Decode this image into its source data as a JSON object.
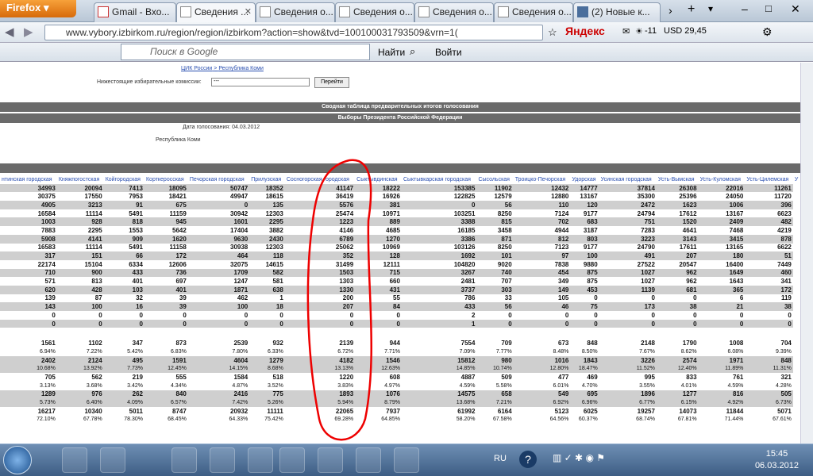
{
  "browser": {
    "menu_label": "Firefox",
    "tabs": [
      "Gmail - Вхо...",
      "Сведения ...",
      "Сведения о...",
      "Сведения о...",
      "Сведения о...",
      "Сведения о...",
      "(2) Новые к..."
    ],
    "url": "www.vybory.izbirkom.ru/region/region/izbirkom?action=show&tvd=100100031793509&vrn=1(",
    "yandex": "Яндекс",
    "temp": "-11",
    "usd": "USD 29,45",
    "search_placeholder": "Поиск в Google",
    "find_label": "Найти",
    "login_label": "Войти"
  },
  "page": {
    "breadcrumb": [
      "ЦИК России",
      ">",
      "Республика Коми"
    ],
    "commission_label": "Нижестоящие избирательные комиссии:",
    "commission_value": "---",
    "go_label": "Перейти",
    "title1": "Сводная таблица предварительных итогов голосования",
    "title2": "Выборы Президента Российской Федерации",
    "date_label": "Дата голосования:",
    "date_value": "04.03.2012",
    "region": "Республика Коми"
  },
  "table": {
    "headers": [
      "нтинская городская",
      "Княжпогостская",
      "Койгородская",
      "Корткеросская",
      "Печорская городская",
      "Прилузская",
      "Сосногорская городская",
      "Сыктывдинская",
      "Сыктывкарская городская",
      "Сысольская",
      "Троицко-Печорская",
      "Удорская",
      "Усинская городская",
      "Усть-Вымская",
      "Усть-Куломская",
      "Усть-Цилемская",
      "У"
    ],
    "rows": [
      [
        "34993",
        "20094",
        "7413",
        "18095",
        "50747",
        "18352",
        "41147",
        "18222",
        "153385",
        "11902",
        "12432",
        "14777",
        "37814",
        "26308",
        "22016",
        "11261"
      ],
      [
        "30375",
        "17550",
        "7953",
        "18421",
        "49947",
        "18615",
        "36419",
        "16926",
        "122825",
        "12579",
        "12880",
        "13167",
        "35300",
        "25396",
        "24050",
        "11720"
      ],
      [
        "4905",
        "3213",
        "91",
        "675",
        "0",
        "135",
        "5576",
        "381",
        "0",
        "56",
        "110",
        "120",
        "2472",
        "1623",
        "1006",
        "396"
      ],
      [
        "16584",
        "11114",
        "5491",
        "11159",
        "30942",
        "12303",
        "25474",
        "10971",
        "103251",
        "8250",
        "7124",
        "9177",
        "24794",
        "17612",
        "13167",
        "6623"
      ],
      [
        "1003",
        "928",
        "818",
        "945",
        "1601",
        "2295",
        "1223",
        "889",
        "3388",
        "815",
        "702",
        "683",
        "751",
        "1520",
        "2409",
        "482"
      ],
      [
        "7883",
        "2295",
        "1553",
        "5642",
        "17404",
        "3882",
        "4146",
        "4685",
        "16185",
        "3458",
        "4944",
        "3187",
        "7283",
        "4641",
        "7468",
        "4219"
      ],
      [
        "5908",
        "4141",
        "909",
        "1620",
        "9630",
        "2430",
        "6789",
        "1270",
        "3386",
        "871",
        "812",
        "803",
        "3223",
        "3143",
        "3415",
        "878"
      ],
      [
        "16583",
        "11114",
        "5491",
        "11158",
        "30938",
        "12303",
        "25062",
        "10969",
        "103126",
        "8250",
        "7123",
        "9177",
        "24790",
        "17611",
        "13165",
        "6622"
      ],
      [
        "317",
        "151",
        "66",
        "172",
        "464",
        "118",
        "352",
        "128",
        "1692",
        "101",
        "97",
        "100",
        "491",
        "207",
        "180",
        "51"
      ],
      [
        "22174",
        "15104",
        "6334",
        "12606",
        "32075",
        "14615",
        "31499",
        "12111",
        "104820",
        "9020",
        "7838",
        "9880",
        "27522",
        "20547",
        "16400",
        "7449"
      ],
      [
        "710",
        "900",
        "433",
        "736",
        "1709",
        "582",
        "1503",
        "715",
        "3267",
        "740",
        "454",
        "875",
        "1027",
        "962",
        "1649",
        "460"
      ],
      [
        "571",
        "813",
        "401",
        "697",
        "1247",
        "581",
        "1303",
        "660",
        "2481",
        "707",
        "349",
        "875",
        "1027",
        "962",
        "1643",
        "341"
      ],
      [
        "620",
        "428",
        "103",
        "401",
        "1871",
        "638",
        "1330",
        "431",
        "3737",
        "303",
        "149",
        "453",
        "1139",
        "681",
        "365",
        "172"
      ],
      [
        "139",
        "87",
        "32",
        "39",
        "462",
        "1",
        "200",
        "55",
        "786",
        "33",
        "105",
        "0",
        "0",
        "0",
        "6",
        "119"
      ],
      [
        "143",
        "100",
        "16",
        "39",
        "100",
        "18",
        "207",
        "84",
        "433",
        "56",
        "46",
        "75",
        "173",
        "38",
        "21",
        "38"
      ],
      [
        "0",
        "0",
        "0",
        "0",
        "0",
        "0",
        "0",
        "0",
        "2",
        "0",
        "0",
        "0",
        "0",
        "0",
        "0",
        "0"
      ],
      [
        "0",
        "0",
        "0",
        "0",
        "0",
        "0",
        "0",
        "0",
        "1",
        "0",
        "0",
        "0",
        "0",
        "0",
        "0",
        "0"
      ]
    ],
    "split_rows": [
      {
        "v": [
          "1561",
          "1102",
          "347",
          "873",
          "2539",
          "932",
          "2139",
          "944",
          "7554",
          "709",
          "673",
          "848",
          "2148",
          "1790",
          "1008",
          "704"
        ],
        "p": [
          "6.94%",
          "7.22%",
          "5.42%",
          "6.83%",
          "7.80%",
          "6.33%",
          "6.72%",
          "7.71%",
          "7.09%",
          "7.77%",
          "8.48%",
          "8.50%",
          "7.67%",
          "8.62%",
          "6.08%",
          "9.39%"
        ]
      },
      {
        "v": [
          "2402",
          "2124",
          "495",
          "1591",
          "4604",
          "1279",
          "4182",
          "1546",
          "15812",
          "980",
          "1016",
          "1843",
          "3226",
          "2574",
          "1971",
          "848"
        ],
        "p": [
          "10.68%",
          "13.92%",
          "7.73%",
          "12.45%",
          "14.15%",
          "8.68%",
          "13.13%",
          "12.63%",
          "14.85%",
          "10.74%",
          "12.80%",
          "18.47%",
          "11.52%",
          "12.40%",
          "11.89%",
          "11.31%"
        ]
      },
      {
        "v": [
          "705",
          "562",
          "219",
          "555",
          "1584",
          "518",
          "1220",
          "608",
          "4887",
          "509",
          "477",
          "469",
          "995",
          "833",
          "761",
          "321"
        ],
        "p": [
          "3.13%",
          "3.68%",
          "3.42%",
          "4.34%",
          "4.87%",
          "3.52%",
          "3.83%",
          "4.97%",
          "4.59%",
          "5.58%",
          "6.01%",
          "4.70%",
          "3.55%",
          "4.01%",
          "4.59%",
          "4.28%"
        ]
      },
      {
        "v": [
          "1289",
          "976",
          "262",
          "840",
          "2416",
          "775",
          "1893",
          "1076",
          "14575",
          "658",
          "549",
          "695",
          "1896",
          "1277",
          "816",
          "505"
        ],
        "p": [
          "5.73%",
          "6.40%",
          "4.09%",
          "6.57%",
          "7.42%",
          "5.26%",
          "5.94%",
          "8.79%",
          "13.68%",
          "7.21%",
          "6.92%",
          "6.96%",
          "6.77%",
          "6.15%",
          "4.92%",
          "6.73%"
        ]
      },
      {
        "v": [
          "16217",
          "10340",
          "5011",
          "8747",
          "20932",
          "11111",
          "22065",
          "7937",
          "61992",
          "6164",
          "5123",
          "6025",
          "19257",
          "14073",
          "11844",
          "5071"
        ],
        "p": [
          "72.10%",
          "67.78%",
          "78.30%",
          "68.45%",
          "64.33%",
          "75.42%",
          "69.28%",
          "64.85%",
          "58.20%",
          "67.58%",
          "64.56%",
          "60.37%",
          "68.74%",
          "67.81%",
          "71.44%",
          "67.61%"
        ]
      }
    ]
  },
  "taskbar": {
    "lang": "RU",
    "time": "15:45",
    "date": "06.03.2012"
  }
}
